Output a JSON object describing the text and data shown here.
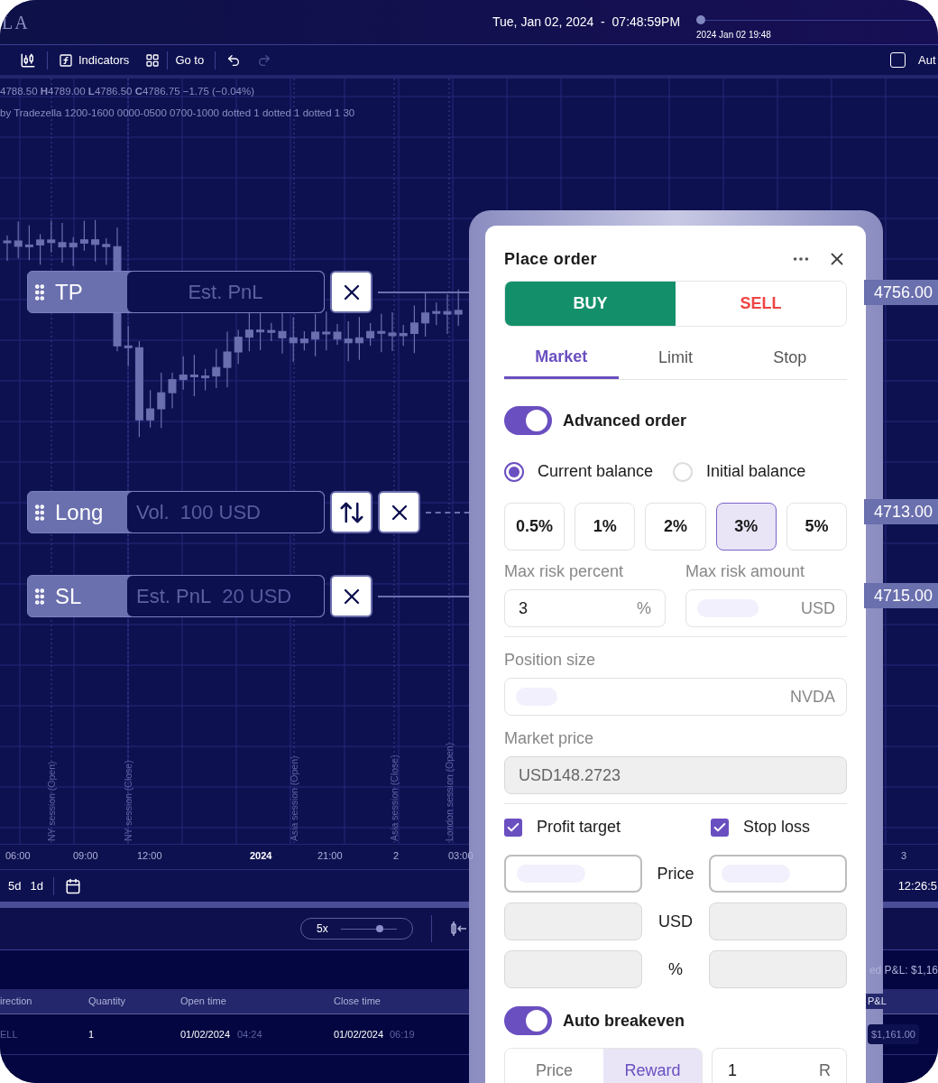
{
  "header": {
    "logo": "LA",
    "datetime": "Tue, Jan 02, 2024  -  07:48:59PM",
    "timeline_label": "2024 Jan 02 19:48",
    "timeline_slider": {
      "level": 0
    }
  },
  "toolbar": {
    "indicators": "Indicators",
    "goto": "Go to",
    "auto": {
      "label": "Aut",
      "checked": false
    }
  },
  "legend": [
    "4788.50 **H**4789.00 **L**4786.50 **C**4786.75 −1.75 (−0.04%)",
    "by Tradezella 1200-1600 0000-0500 0700-1000 dotted 1 dotted 1 dotted 1 30"
  ],
  "order_lines": [
    {
      "kind": "target",
      "label": "TP",
      "field": "Est. PnL"
    },
    {
      "kind": "entry",
      "label": "Long",
      "field": "Vol.",
      "value": "100 USD"
    },
    {
      "kind": "target",
      "label": "SL",
      "field": "Est. PnL",
      "value": "20 USD"
    }
  ],
  "price_labels": [
    "4756.00",
    "4713.00",
    "4715.00"
  ],
  "sessions": [
    "NY session (Open)",
    "NY session (Close)",
    "Asia session (Open)",
    "Asia session (Close)",
    "London session (Open)"
  ],
  "time_axis": [
    {
      "label": "06:00",
      "kind": "time"
    },
    {
      "label": "09:00",
      "kind": "time"
    },
    {
      "label": "12:00",
      "kind": "time"
    },
    {
      "label": "2024",
      "kind": "year"
    },
    {
      "label": "21:00",
      "kind": "time"
    },
    {
      "label": "2",
      "kind": "time"
    },
    {
      "label": "03:00",
      "kind": "time"
    },
    {
      "label": "3",
      "kind": "time"
    }
  ],
  "range_bar": {
    "ranges": [
      "5d",
      "1d"
    ],
    "clock": "12:26:5"
  },
  "replay": {
    "speed": "5x",
    "level": 0.7
  },
  "summary": "ed P&L: $1,16",
  "table": {
    "columns": [
      "irection",
      "Quantity",
      "Open time",
      "Close time",
      "P&L"
    ],
    "rows": [
      {
        "direction": "ELL",
        "quantity": "1",
        "open_date": "01/02/2024",
        "open_time": "04:24",
        "close_date": "01/02/2024",
        "close_time": "06:19",
        "pnl": "$1,161.00"
      }
    ]
  },
  "order_panel": {
    "title": "Place order",
    "sides": [
      {
        "label": "BUY",
        "kind": "buy",
        "selected": true
      },
      {
        "label": "SELL",
        "kind": "sell",
        "selected": false
      }
    ],
    "tabs": [
      {
        "label": "Market",
        "selected": true
      },
      {
        "label": "Limit",
        "selected": false
      },
      {
        "label": "Stop",
        "selected": false
      }
    ],
    "advanced_order": {
      "label": "Advanced order",
      "on": true
    },
    "balance_options": [
      {
        "label": "Current balance",
        "selected": true
      },
      {
        "label": "Initial balance",
        "selected": false
      }
    ],
    "risk_presets": [
      {
        "label": "0.5%",
        "selected": false
      },
      {
        "label": "1%",
        "selected": false
      },
      {
        "label": "2%",
        "selected": false
      },
      {
        "label": "3%",
        "selected": true
      },
      {
        "label": "5%",
        "selected": false
      }
    ],
    "max_risk_percent": {
      "label": "Max risk percent",
      "value": "3",
      "unit": "%"
    },
    "max_risk_amount": {
      "label": "Max risk amount",
      "unit": "USD"
    },
    "position_size": {
      "label": "Position size",
      "unit": "NVDA"
    },
    "market_price": {
      "label": "Market price",
      "value": "USD148.2723",
      "disabled": true
    },
    "profit_target": {
      "label": "Profit target",
      "checked": true
    },
    "stop_loss": {
      "label": "Stop loss",
      "checked": true
    },
    "row_labels": [
      "Price",
      "USD",
      "%"
    ],
    "auto_breakeven": {
      "label": "Auto breakeven",
      "on": true
    },
    "breakeven_modes": [
      {
        "label": "Price",
        "selected": false
      },
      {
        "label": "Reward",
        "selected": true
      }
    ],
    "breakeven_value": {
      "value": "1",
      "unit": "R"
    }
  }
}
